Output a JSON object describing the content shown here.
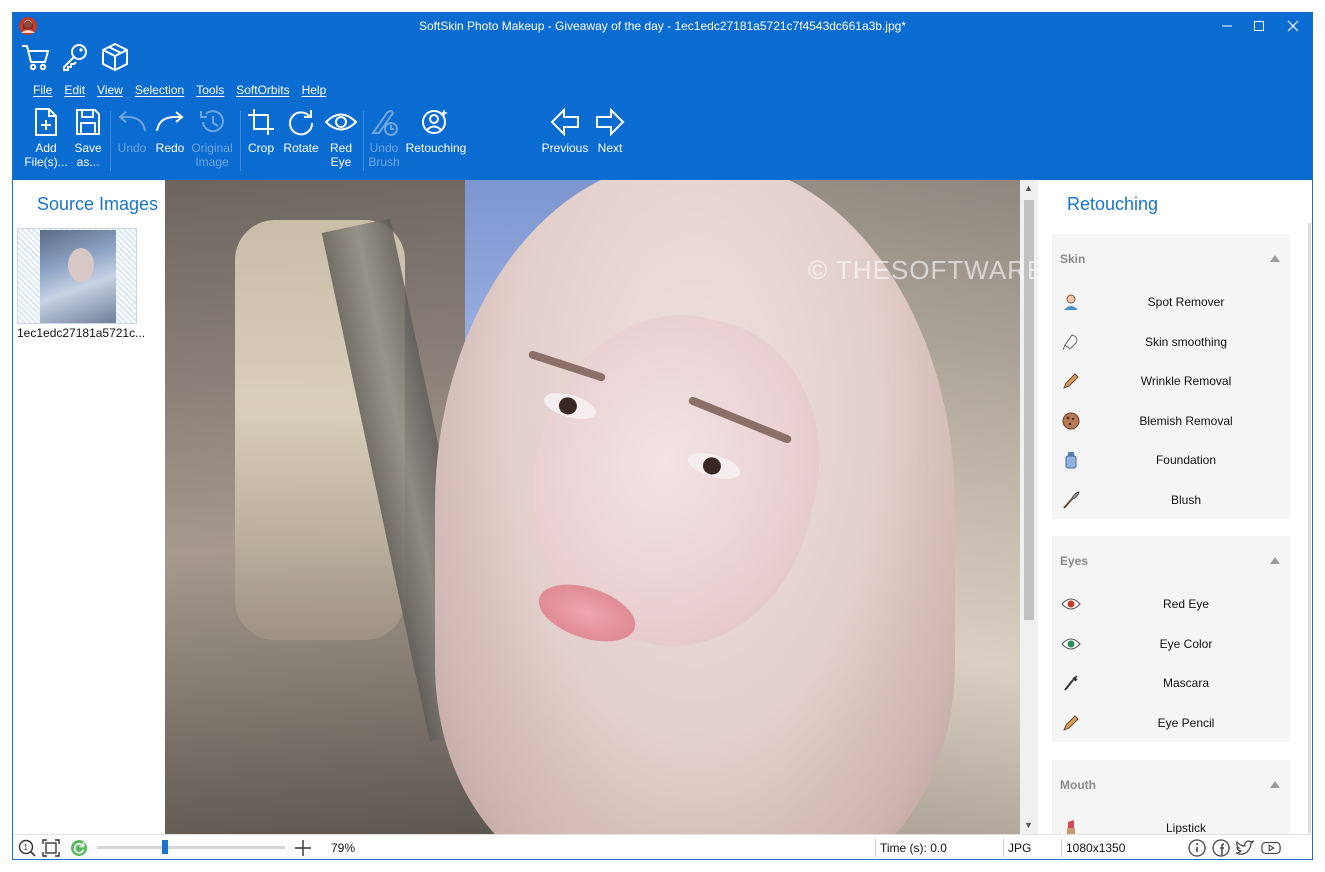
{
  "window": {
    "title": "SoftSkin Photo Makeup - Giveaway of the day - 1ec1edc27181a5721c7f4543dc661a3b.jpg*",
    "accent_color": "#0a6bd1"
  },
  "quick_icons": [
    "cart-icon",
    "key-icon",
    "box-icon"
  ],
  "menu": [
    "File",
    "Edit",
    "View",
    "Selection",
    "Tools",
    "SoftOrbits",
    "Help"
  ],
  "toolbar": {
    "add_files": "Add\nFile(s)...",
    "save_as": "Save\nas...",
    "undo": "Undo",
    "redo": "Redo",
    "original_image": "Original\nImage",
    "crop": "Crop",
    "rotate": "Rotate",
    "red_eye": "Red\nEye",
    "undo_brush": "Undo\nBrush",
    "retouching": "Retouching",
    "previous": "Previous",
    "next": "Next"
  },
  "left_panel": {
    "title": "Source Images",
    "thumb_caption": "1ec1edc27181a5721c..."
  },
  "canvas": {
    "watermark": "© THESOFTWARE.SHOP"
  },
  "right_panel": {
    "title": "Retouching",
    "sections": [
      {
        "label": "Skin",
        "items": [
          "Spot Remover",
          "Skin smoothing",
          "Wrinkle Removal",
          "Blemish Removal",
          "Foundation",
          "Blush"
        ]
      },
      {
        "label": "Eyes",
        "items": [
          "Red Eye",
          "Eye Color",
          "Mascara",
          "Eye Pencil"
        ]
      },
      {
        "label": "Mouth",
        "items": [
          "Lipstick"
        ]
      }
    ]
  },
  "statusbar": {
    "zoom": "79%",
    "zoom_fraction": 0.36,
    "time": "Time (s): 0.0",
    "format": "JPG",
    "dimensions": "1080x1350"
  }
}
